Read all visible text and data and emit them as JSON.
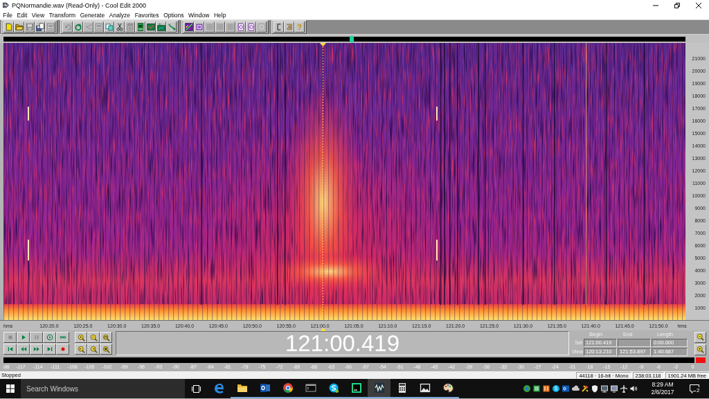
{
  "window": {
    "title": "PQNormandie.wav (Read-Only) - Cool Edit 2000"
  },
  "menu": [
    "File",
    "Edit",
    "View",
    "Transform",
    "Generate",
    "Analyze",
    "Favorites",
    "Options",
    "Window",
    "Help"
  ],
  "toolbar": [
    [
      {
        "kind": "page",
        "disabled": false
      },
      {
        "kind": "folder",
        "disabled": false
      },
      {
        "kind": "disk",
        "disabled": true
      },
      {
        "kind": "disk-pages",
        "disabled": false
      },
      {
        "kind": "panel",
        "disabled": true
      }
    ],
    [
      {
        "kind": "undo",
        "disabled": true
      },
      {
        "kind": "cycle",
        "disabled": false
      },
      {
        "kind": "branch",
        "disabled": true
      },
      {
        "kind": "panel",
        "disabled": true
      },
      {
        "kind": "copy",
        "disabled": false
      },
      {
        "kind": "cut",
        "disabled": false
      },
      {
        "kind": "paste",
        "disabled": true
      },
      {
        "kind": "figure",
        "disabled": false
      },
      {
        "kind": "chart",
        "disabled": false
      },
      {
        "kind": "chart-star",
        "disabled": false
      },
      {
        "kind": "squiggle",
        "disabled": false
      }
    ],
    [
      {
        "kind": "spectral",
        "disabled": false
      },
      {
        "kind": "small-page",
        "disabled": false
      },
      {
        "kind": "grid",
        "disabled": true
      },
      {
        "kind": "grid",
        "disabled": true
      },
      {
        "kind": "grid",
        "disabled": true
      },
      {
        "kind": "document",
        "disabled": false
      },
      {
        "kind": "document",
        "disabled": false
      },
      {
        "kind": "disc",
        "disabled": true
      }
    ],
    [
      {
        "kind": "bracket",
        "disabled": false
      },
      {
        "kind": "scroll",
        "disabled": false
      },
      {
        "kind": "help",
        "glyph": "?",
        "disabled": false
      }
    ]
  ],
  "frequency_axis": {
    "labels": [
      "21000",
      "20000",
      "19000",
      "18000",
      "17000",
      "16000",
      "15000",
      "14000",
      "13000",
      "12000",
      "11000",
      "10000",
      "9000",
      "8000",
      "7000",
      "6000",
      "5000",
      "4000",
      "3000",
      "2000",
      "1000"
    ]
  },
  "time_axis": {
    "start_unit": "hms",
    "labels": [
      "120:20.0",
      "120:25.0",
      "120:30.0",
      "120:35.0",
      "120:40.0",
      "120:45.0",
      "120:50.0",
      "120:55.0",
      "121:00.0",
      "121:05.0",
      "121:10.0",
      "121:15.0",
      "121:20.0",
      "121:25.0",
      "121:30.0",
      "121:35.0",
      "121:40.0",
      "121:45.0",
      "121:50.0"
    ],
    "end_unit": "hms"
  },
  "transport": [
    {
      "kind": "stop",
      "disabled": true
    },
    {
      "kind": "play",
      "disabled": false
    },
    {
      "kind": "pause",
      "disabled": true
    },
    {
      "kind": "play-to-end",
      "disabled": false
    },
    {
      "kind": "loop",
      "disabled": false
    },
    {
      "kind": "go-start",
      "disabled": false
    },
    {
      "kind": "rewind",
      "disabled": false
    },
    {
      "kind": "fast-forward",
      "disabled": false
    },
    {
      "kind": "go-end",
      "disabled": false
    },
    {
      "kind": "record",
      "disabled": false
    }
  ],
  "time_display": "121:00.419",
  "selection": {
    "columns": [
      "Begin",
      "End",
      "Length"
    ],
    "rows": [
      {
        "label": "Sel",
        "begin": "121:00.419",
        "length": "0:00.000"
      },
      {
        "label": "View",
        "begin": "120:13.210",
        "end": "121:53.897",
        "length": "1:40.687"
      }
    ]
  },
  "level_meter": {
    "unit": "dB",
    "labels": [
      "-117",
      "-114",
      "-111",
      "-108",
      "-105",
      "-102",
      "-99",
      "-96",
      "-93",
      "-90",
      "-87",
      "-84",
      "-81",
      "-78",
      "-75",
      "-72",
      "-69",
      "-66",
      "-63",
      "-60",
      "-57",
      "-54",
      "-51",
      "-48",
      "-45",
      "-42",
      "-39",
      "-36",
      "-33",
      "-30",
      "-27",
      "-24",
      "-21",
      "-18",
      "-15",
      "-12",
      "-9",
      "-6",
      "-3",
      "0"
    ]
  },
  "status_bar": {
    "state": "Stopped",
    "format": "44118 · 16-bit · Mono",
    "duration": "238:03.118",
    "free_space": "1901.24 MB free"
  },
  "taskbar": {
    "search": {
      "placeholder": "Search Windows"
    },
    "apps": [
      {
        "kind": "edge",
        "running": false,
        "selected": false
      },
      {
        "kind": "explorer",
        "running": true,
        "selected": false
      },
      {
        "kind": "outlook",
        "running": true,
        "selected": false
      },
      {
        "kind": "chrome",
        "running": true,
        "selected": false
      },
      {
        "kind": "terminal",
        "running": true,
        "selected": false
      },
      {
        "kind": "skype",
        "running": true,
        "selected": false
      },
      {
        "kind": "pycharm",
        "running": true,
        "selected": false
      },
      {
        "kind": "cool-edit",
        "running": true,
        "selected": true
      },
      {
        "kind": "calculator",
        "running": true,
        "selected": false
      },
      {
        "kind": "photos",
        "running": true,
        "selected": false
      },
      {
        "kind": "paint",
        "running": true,
        "selected": false
      }
    ],
    "clock": {
      "time": "8:29 AM",
      "date": "2/6/2017"
    },
    "notifications": "2"
  }
}
